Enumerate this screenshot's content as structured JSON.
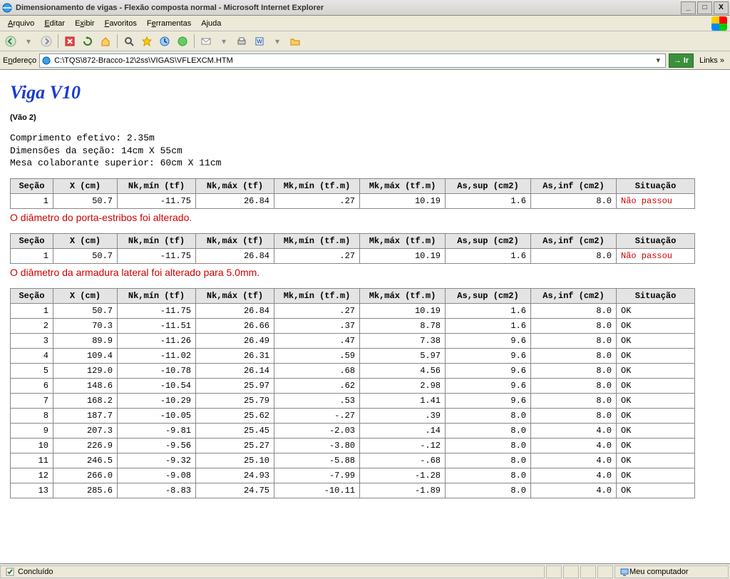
{
  "window": {
    "title": "Dimensionamento de vigas - Flexão composta normal - Microsoft Internet Explorer"
  },
  "menu": {
    "arquivo": "Arquivo",
    "editar": "Editar",
    "exibir": "Exibir",
    "favoritos": "Favoritos",
    "ferramentas": "Ferramentas",
    "ajuda": "Ajuda"
  },
  "address": {
    "label": "Endereço",
    "value": "C:\\TQS\\872-Bracco-12\\2ss\\VIGAS\\VFLEXCM.HTM",
    "go": "Ir",
    "links": "Links"
  },
  "page": {
    "heading": "Viga V10",
    "vao": "(Vão 2)",
    "info1": "Comprimento efetivo: 2.35m",
    "info2": "Dimensões da seção: 14cm X 55cm",
    "info3": "Mesa colaborante superior: 60cm X 11cm",
    "warn1": "O diâmetro do porta-estribos foi alterado.",
    "warn2": "O diâmetro da armadura lateral foi alterado para 5.0mm."
  },
  "headers": {
    "secao": "Seção",
    "x": "X (cm)",
    "nkmin": "Nk,mín (tf)",
    "nkmax": "Nk,máx (tf)",
    "mkmin": "Mk,mín (tf.m)",
    "mkmax": "Mk,máx (tf.m)",
    "assup": "As,sup (cm2)",
    "asinf": "As,inf (cm2)",
    "sit": "Situação"
  },
  "table1": {
    "rows": [
      {
        "secao": "1",
        "x": "50.7",
        "nkmin": "-11.75",
        "nkmax": "26.84",
        "mkmin": ".27",
        "mkmax": "10.19",
        "assup": "1.6",
        "asinf": "8.0",
        "sit": "Não passou",
        "fail": true
      }
    ]
  },
  "table2": {
    "rows": [
      {
        "secao": "1",
        "x": "50.7",
        "nkmin": "-11.75",
        "nkmax": "26.84",
        "mkmin": ".27",
        "mkmax": "10.19",
        "assup": "1.6",
        "asinf": "8.0",
        "sit": "Não passou",
        "fail": true
      }
    ]
  },
  "table3": {
    "rows": [
      {
        "secao": "1",
        "x": "50.7",
        "nkmin": "-11.75",
        "nkmax": "26.84",
        "mkmin": ".27",
        "mkmax": "10.19",
        "assup": "1.6",
        "asinf": "8.0",
        "sit": "OK"
      },
      {
        "secao": "2",
        "x": "70.3",
        "nkmin": "-11.51",
        "nkmax": "26.66",
        "mkmin": ".37",
        "mkmax": "8.78",
        "assup": "1.6",
        "asinf": "8.0",
        "sit": "OK"
      },
      {
        "secao": "3",
        "x": "89.9",
        "nkmin": "-11.26",
        "nkmax": "26.49",
        "mkmin": ".47",
        "mkmax": "7.38",
        "assup": "9.6",
        "asinf": "8.0",
        "sit": "OK"
      },
      {
        "secao": "4",
        "x": "109.4",
        "nkmin": "-11.02",
        "nkmax": "26.31",
        "mkmin": ".59",
        "mkmax": "5.97",
        "assup": "9.6",
        "asinf": "8.0",
        "sit": "OK"
      },
      {
        "secao": "5",
        "x": "129.0",
        "nkmin": "-10.78",
        "nkmax": "26.14",
        "mkmin": ".68",
        "mkmax": "4.56",
        "assup": "9.6",
        "asinf": "8.0",
        "sit": "OK"
      },
      {
        "secao": "6",
        "x": "148.6",
        "nkmin": "-10.54",
        "nkmax": "25.97",
        "mkmin": ".62",
        "mkmax": "2.98",
        "assup": "9.6",
        "asinf": "8.0",
        "sit": "OK"
      },
      {
        "secao": "7",
        "x": "168.2",
        "nkmin": "-10.29",
        "nkmax": "25.79",
        "mkmin": ".53",
        "mkmax": "1.41",
        "assup": "9.6",
        "asinf": "8.0",
        "sit": "OK"
      },
      {
        "secao": "8",
        "x": "187.7",
        "nkmin": "-10.05",
        "nkmax": "25.62",
        "mkmin": "-.27",
        "mkmax": ".39",
        "assup": "8.0",
        "asinf": "8.0",
        "sit": "OK"
      },
      {
        "secao": "9",
        "x": "207.3",
        "nkmin": "-9.81",
        "nkmax": "25.45",
        "mkmin": "-2.03",
        "mkmax": ".14",
        "assup": "8.0",
        "asinf": "4.0",
        "sit": "OK"
      },
      {
        "secao": "10",
        "x": "226.9",
        "nkmin": "-9.56",
        "nkmax": "25.27",
        "mkmin": "-3.80",
        "mkmax": "-.12",
        "assup": "8.0",
        "asinf": "4.0",
        "sit": "OK"
      },
      {
        "secao": "11",
        "x": "246.5",
        "nkmin": "-9.32",
        "nkmax": "25.10",
        "mkmin": "-5.88",
        "mkmax": "-.68",
        "assup": "8.0",
        "asinf": "4.0",
        "sit": "OK"
      },
      {
        "secao": "12",
        "x": "266.0",
        "nkmin": "-9.08",
        "nkmax": "24.93",
        "mkmin": "-7.99",
        "mkmax": "-1.28",
        "assup": "8.0",
        "asinf": "4.0",
        "sit": "OK"
      },
      {
        "secao": "13",
        "x": "285.6",
        "nkmin": "-8.83",
        "nkmax": "24.75",
        "mkmin": "-10.11",
        "mkmax": "-1.89",
        "assup": "8.0",
        "asinf": "4.0",
        "sit": "OK"
      }
    ]
  },
  "status": {
    "left": "Concluído",
    "right": "Meu computador"
  }
}
